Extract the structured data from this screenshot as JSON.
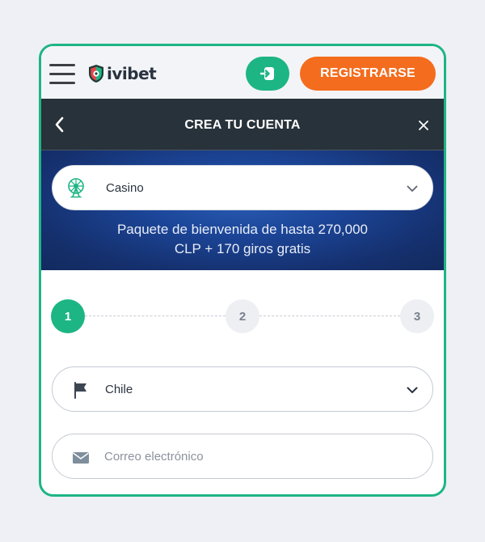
{
  "topbar": {
    "menu_icon": "hamburger-menu-icon",
    "logo_text": "ivibet",
    "login_icon": "login-arrow-icon",
    "register_label": "REGISTRARSE"
  },
  "header": {
    "title": "CREA TU CUENTA",
    "back_icon": "chevron-left-icon",
    "close_icon": "close-icon"
  },
  "banner": {
    "bonus_type": {
      "selected": "Casino",
      "icon": "ferris-wheel-icon"
    },
    "bonus_line1": "Paquete de bienvenida de hasta 270,000",
    "bonus_line2": "CLP + 170 giros gratis"
  },
  "steps": [
    {
      "label": "1",
      "active": true
    },
    {
      "label": "2",
      "active": false
    },
    {
      "label": "3",
      "active": false
    }
  ],
  "form": {
    "country": {
      "value": "Chile",
      "icon": "flag-icon"
    },
    "email": {
      "placeholder": "Correo electrónico",
      "value": "",
      "icon": "envelope-icon"
    }
  },
  "colors": {
    "accent_green": "#1db584",
    "register_orange": "#f46c1d",
    "header_dark": "#27323a",
    "banner_blue": "#1c4699"
  }
}
